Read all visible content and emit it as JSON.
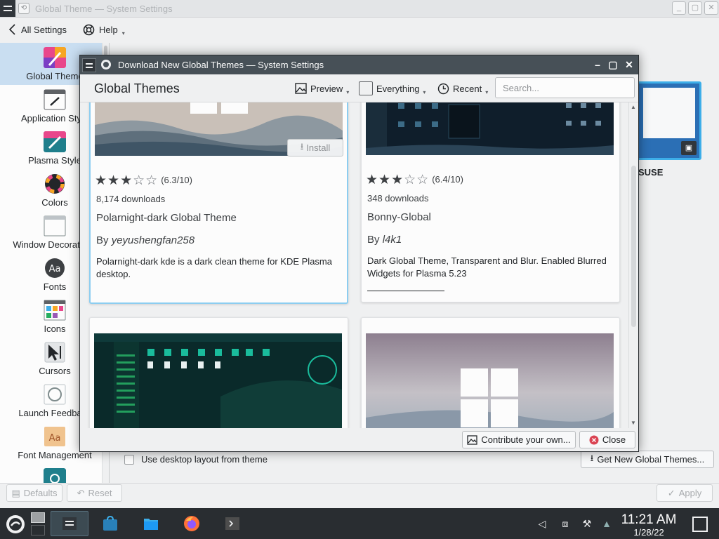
{
  "main_window": {
    "title": "Global Theme — System Settings",
    "toolbar": {
      "back_label": "All Settings",
      "help_label": "Help"
    }
  },
  "sidebar": {
    "items": [
      {
        "label": "Global Theme",
        "icon": "global-theme-icon",
        "active": true
      },
      {
        "label": "Application Style",
        "icon": "application-style-icon"
      },
      {
        "label": "Plasma Style",
        "icon": "plasma-style-icon"
      },
      {
        "label": "Colors",
        "icon": "colors-icon"
      },
      {
        "label": "Window Decorations",
        "icon": "window-decorations-icon"
      },
      {
        "label": "Fonts",
        "icon": "fonts-icon"
      },
      {
        "label": "Icons",
        "icon": "icons-icon"
      },
      {
        "label": "Cursors",
        "icon": "cursors-icon"
      },
      {
        "label": "Launch Feedback",
        "icon": "launch-feedback-icon"
      },
      {
        "label": "Font Management",
        "icon": "font-management-icon"
      }
    ]
  },
  "content": {
    "theme_label": "SUSE",
    "use_desktop_layout_label": "Use desktop layout from theme",
    "get_new_themes_label": "Get New Global Themes..."
  },
  "bottom_bar": {
    "defaults_label": "Defaults",
    "reset_label": "Reset",
    "apply_label": "Apply"
  },
  "dialog": {
    "title": "Download New Global Themes — System Settings",
    "heading": "Global Themes",
    "preview_label": "Preview",
    "filter_label": "Everything",
    "sort_label": "Recent",
    "search_placeholder": "Search...",
    "contribute_label": "Contribute your own...",
    "close_label": "Close",
    "cards": [
      {
        "name": "Polarnight-dark Global Theme",
        "author": "yeyushengfan258",
        "by": "By",
        "rating": "(6.3/10)",
        "stars": 3,
        "downloads": "8,174 downloads",
        "description": "Polarnight-dark kde is a dark clean theme for KDE Plasma desktop.",
        "install_label": "Install"
      },
      {
        "name": "Bonny-Global",
        "author": "l4k1",
        "by": "By",
        "rating": "(6.4/10)",
        "stars": 3,
        "downloads": "348 downloads",
        "description": "Dark Global Theme, Transparent and Blur. Enabled Blurred Widgets for Plasma 5.23"
      }
    ]
  },
  "taskbar": {
    "time": "11:21 AM",
    "date": "1/28/22"
  },
  "colors": {
    "accent": "#3daee9",
    "selection": "#c9def1",
    "titlebar": "#475057",
    "taskbar": "#292d31",
    "close_red": "#da4453"
  }
}
